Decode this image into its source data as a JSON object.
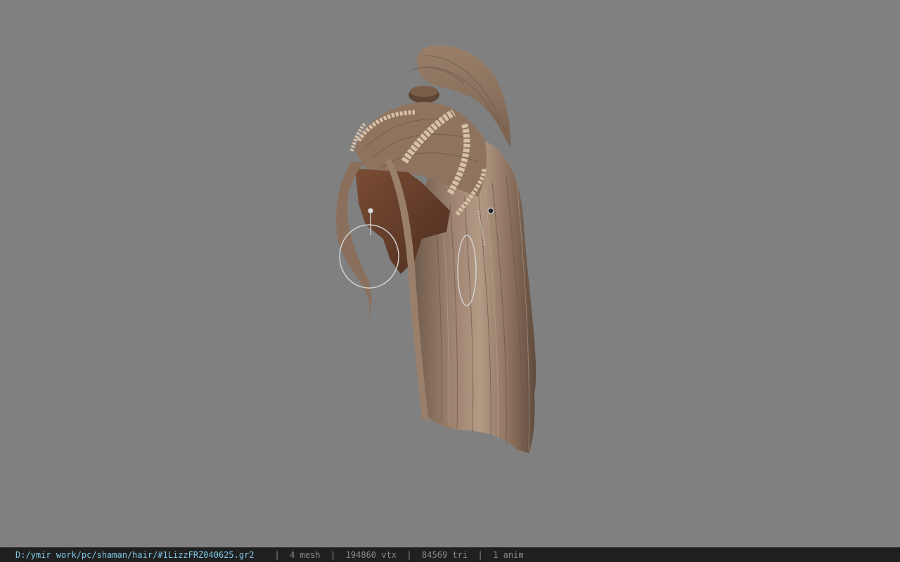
{
  "viewport": {
    "background_color": "#808080",
    "model_label": "hair mesh with braids, high ponytail and hoop earrings"
  },
  "statusbar": {
    "file_path": "D:/ymir work/pc/shaman/hair/#1LizzFRZ040625.gr2",
    "separator": "|",
    "mesh_count": "4 mesh",
    "vertex_count": "194860 vtx",
    "triangle_count": "84569 tri",
    "anim_count": "1 anim",
    "path_color": "#7fc8e8",
    "text_color": "#8a8a8a"
  }
}
